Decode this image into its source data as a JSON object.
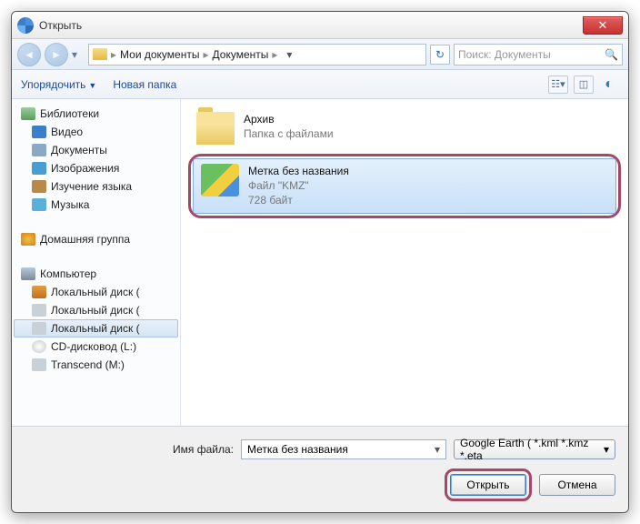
{
  "title": "Открыть",
  "breadcrumbs": {
    "level1": "Мои документы",
    "level2": "Документы"
  },
  "search": {
    "placeholder": "Поиск: Документы"
  },
  "toolbar": {
    "organize": "Упорядочить",
    "new_folder": "Новая папка"
  },
  "sidebar": {
    "items": [
      {
        "label": "Библиотеки",
        "icon": "i-lib"
      },
      {
        "label": "Видео",
        "icon": "i-vid"
      },
      {
        "label": "Документы",
        "icon": "i-doc"
      },
      {
        "label": "Изображения",
        "icon": "i-img"
      },
      {
        "label": "Изучение языка",
        "icon": "i-stu"
      },
      {
        "label": "Музыка",
        "icon": "i-mus"
      }
    ],
    "homegroup": {
      "label": "Домашняя группа"
    },
    "computer": {
      "label": "Компьютер",
      "drives": [
        {
          "label": "Локальный диск (",
          "icon": "i-dc"
        },
        {
          "label": "Локальный диск (",
          "icon": "i-dd"
        },
        {
          "label": "Локальный диск (",
          "icon": "i-dd",
          "sel": true
        },
        {
          "label": "CD-дисковод (L:)",
          "icon": "i-cd"
        },
        {
          "label": "Transcend (M:)",
          "icon": "i-dd"
        }
      ]
    }
  },
  "files": [
    {
      "name": "Архив",
      "sub1": "Папка с файлами",
      "sub2": "",
      "type": "folder"
    },
    {
      "name": "Метка без названия",
      "sub1": "Файл \"KMZ\"",
      "sub2": "728 байт",
      "type": "kmz"
    }
  ],
  "bottom": {
    "filename_label": "Имя файла:",
    "filename_value": "Метка без названия",
    "filter_label": "Google Earth ( *.kml *.kmz *.eta",
    "open_label": "Открыть",
    "cancel_label": "Отмена"
  }
}
